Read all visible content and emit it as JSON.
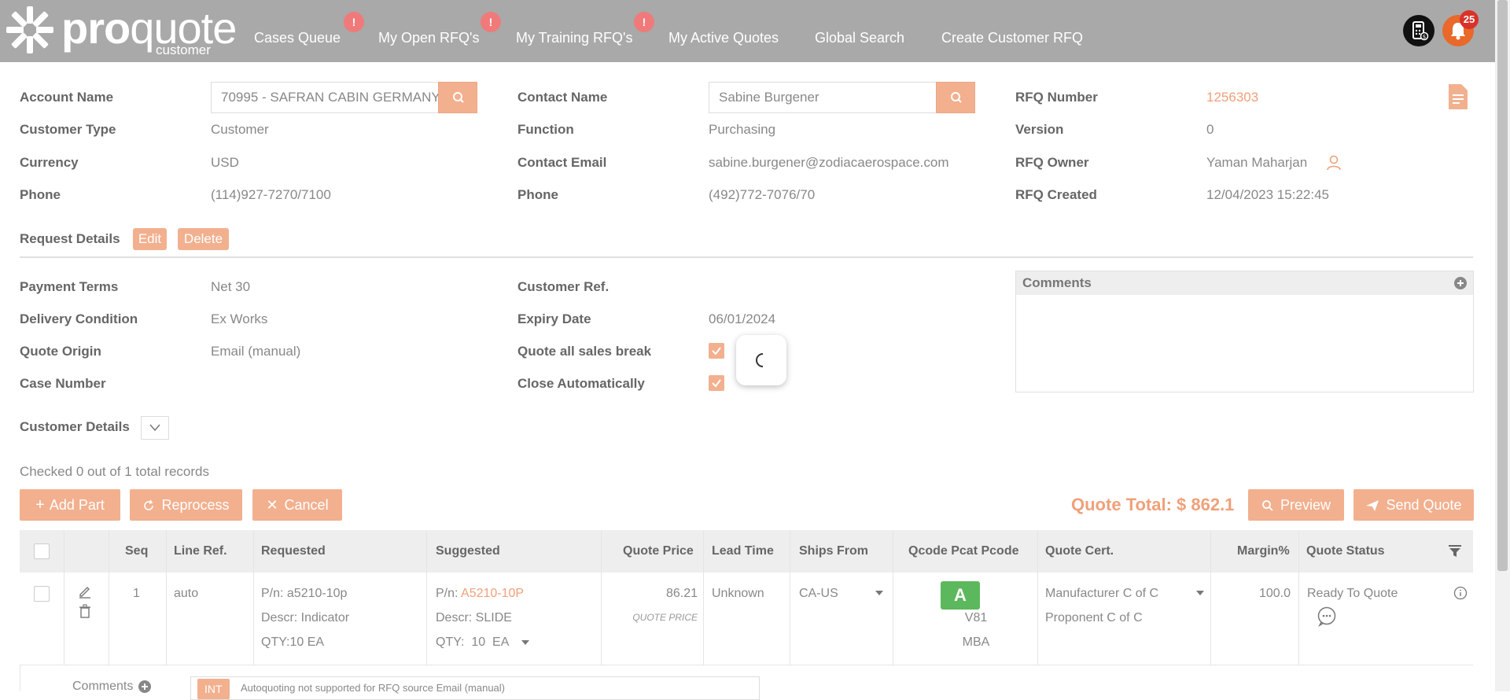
{
  "header": {
    "logo": {
      "pro": "pro",
      "quote": "quote",
      "sub": "customer"
    },
    "nav": [
      {
        "label": "Cases Queue",
        "badge": "!"
      },
      {
        "label": "My Open RFQ's",
        "badge": "!"
      },
      {
        "label": "My Training RFQ's",
        "badge": "!"
      },
      {
        "label": "My Active Quotes"
      },
      {
        "label": "Global Search"
      },
      {
        "label": "Create Customer RFQ"
      }
    ],
    "notification_count": "25"
  },
  "account": {
    "account_name_label": "Account Name",
    "account_name_value": "70995 - SAFRAN CABIN GERMANY",
    "customer_type_label": "Customer Type",
    "customer_type_value": "Customer",
    "currency_label": "Currency",
    "currency_value": "USD",
    "phone_label": "Phone",
    "phone_value": "(114)927-7270/7100"
  },
  "contact": {
    "contact_name_label": "Contact Name",
    "contact_name_value": "Sabine  Burgener",
    "function_label": "Function",
    "function_value": "Purchasing",
    "email_label": "Contact Email",
    "email_value": "sabine.burgener@zodiacaerospace.com",
    "phone_label": "Phone",
    "phone_value": "(492)772-7076/70"
  },
  "rfq": {
    "number_label": "RFQ Number",
    "number_value": "1256303",
    "version_label": "Version",
    "version_value": "0",
    "owner_label": "RFQ Owner",
    "owner_value": "Yaman Maharjan",
    "created_label": "RFQ Created",
    "created_value": "12/04/2023 15:22:45"
  },
  "request": {
    "title": "Request Details",
    "edit_label": "Edit",
    "delete_label": "Delete",
    "payment_terms_label": "Payment Terms",
    "payment_terms_value": "Net 30",
    "delivery_label": "Delivery Condition",
    "delivery_value": "Ex Works",
    "origin_label": "Quote Origin",
    "origin_value": "Email (manual)",
    "case_label": "Case Number",
    "case_value": "",
    "customer_ref_label": "Customer Ref.",
    "customer_ref_value": "",
    "expiry_label": "Expiry Date",
    "expiry_value": "06/01/2024",
    "quote_all_label": "Quote all sales break",
    "quote_all_checked": true,
    "close_auto_label": "Close Automatically",
    "close_auto_checked": true,
    "comments_title": "Comments",
    "customer_details_label": "Customer Details"
  },
  "records": {
    "checked_text": "Checked 0 out of 1 total records",
    "add_part": "Add Part",
    "reprocess": "Reprocess",
    "cancel": "Cancel",
    "quote_total": "Quote Total: $ 862.1",
    "preview": "Preview",
    "send_quote": "Send Quote"
  },
  "table": {
    "headers": [
      "Seq",
      "Line Ref.",
      "Requested",
      "Suggested",
      "Quote Price",
      "Lead Time",
      "Ships From",
      "Qcode Pcat Pcode",
      "Quote Cert.",
      "Margin%",
      "Quote Status"
    ],
    "row": {
      "seq": "1",
      "line_ref": "auto",
      "req_pn": "P/n: a5210-10p",
      "req_descr": "Descr: Indicator",
      "req_qty": "QTY:10 EA",
      "sug_pn_label": "P/n:",
      "sug_pn_value": "A5210-10P",
      "sug_descr": "Descr: SLIDE",
      "sug_qty_label": "QTY:",
      "sug_qty_value": "10",
      "sug_qty_unit": "EA",
      "quote_price": "86.21",
      "quote_price_sub": "QUOTE PRICE",
      "lead_time": "Unknown",
      "ships_from": "CA-US",
      "qcode": "A",
      "pcat": "V81",
      "pcode": "MBA",
      "cert_1": "Manufacturer C of C",
      "cert_2": "Proponent C of C",
      "margin": "100.0",
      "status": "Ready To Quote"
    },
    "comments_label": "Comments",
    "int_tag": "INT",
    "comment_text": "Autoquoting not supported for RFQ source Email (manual)"
  },
  "colors": {
    "accent": "#f2b08f",
    "accent_text": "#f0a07a",
    "topbar": "#a9a9a9",
    "success": "#5cb85c",
    "bell": "#e8692a"
  }
}
